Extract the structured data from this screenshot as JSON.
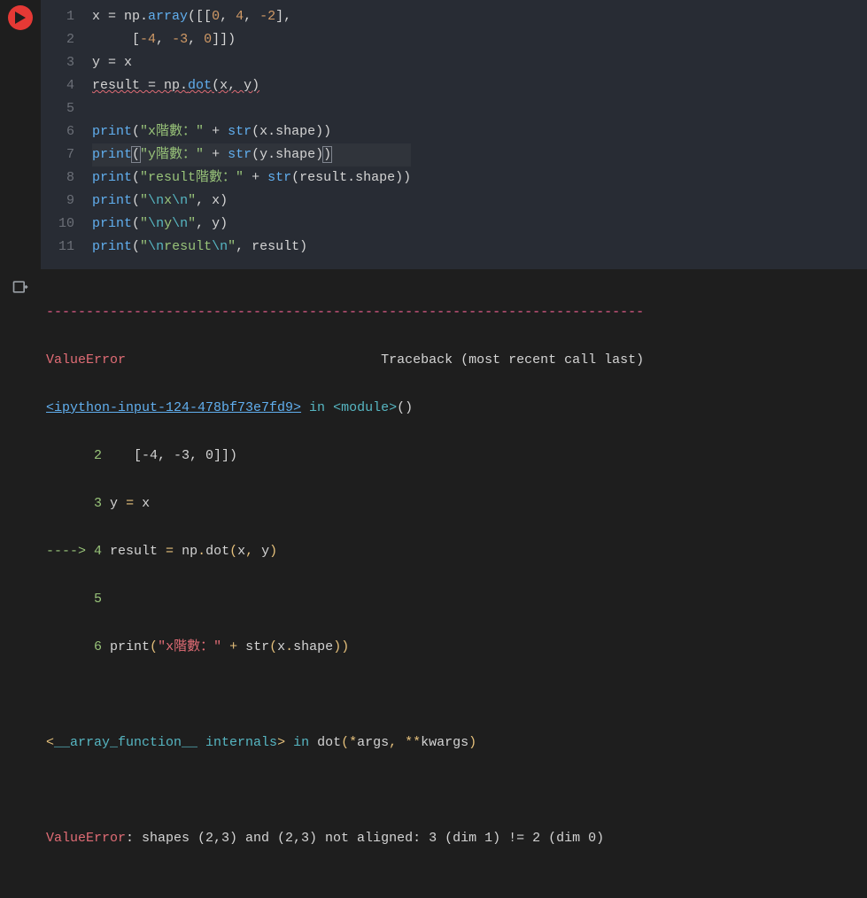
{
  "editor": {
    "line_numbers": [
      "1",
      "2",
      "3",
      "4",
      "5",
      "6",
      "7",
      "8",
      "9",
      "10",
      "11"
    ],
    "active_line": 7,
    "code": {
      "l1": {
        "pre": "x = np.",
        "array": "array",
        "tail": "([[",
        "n0": "0",
        "c1": ", ",
        "n1": "4",
        "c2": ", ",
        "n2": "-2",
        "end": "],"
      },
      "l2": {
        "indent": "     [",
        "n0": "-4",
        "c1": ", ",
        "n1": "-3",
        "c2": ", ",
        "n2": "0",
        "end": "]])"
      },
      "l3": "y = x",
      "l4": {
        "lhs": "result = np.",
        "dot": "dot",
        "args": "(x, y)"
      },
      "l5": "",
      "l6": {
        "p": "print",
        "open": "(",
        "s": "\"x階數：\"",
        "plus": " + ",
        "str": "str",
        "arg": "(x.shape))"
      },
      "l7": {
        "p": "print",
        "open": "(",
        "s": "\"y階數：\"",
        "plus": " + ",
        "str": "str",
        "arg": "(y.shape)",
        "close": ")"
      },
      "l8": {
        "p": "print",
        "open": "(",
        "s": "\"result階數：\"",
        "plus": " + ",
        "str": "str",
        "arg": "(result.shape))"
      },
      "l9": {
        "p": "print",
        "open": "(",
        "s": "\"\\nx\\n\"",
        "rest": ", x)"
      },
      "l10": {
        "p": "print",
        "open": "(",
        "s": "\"\\ny\\n\"",
        "rest": ", y)"
      },
      "l11": {
        "p": "print",
        "open": "(",
        "s": "\"\\nresult\\n\"",
        "rest": ", result)"
      }
    }
  },
  "output": {
    "dashes": "---------------------------------------------------------------------------",
    "error_name": "ValueError",
    "traceback_label": "Traceback (most recent call last)",
    "link": "<ipython-input-124-478bf73e7fd9>",
    "in_label": " in ",
    "module": "<module>",
    "module_tail": "()",
    "tb": [
      {
        "num": "2",
        "code": "    [-4, -3, 0]])",
        "arrow": "      "
      },
      {
        "num": "3",
        "code": " y = x",
        "arrow": "      ",
        "var": "y"
      },
      {
        "num": "4",
        "code": " result = np.dot(x, y)",
        "arrow": "----> "
      },
      {
        "num": "5",
        "code": "",
        "arrow": "      "
      },
      {
        "num": "6",
        "code": " print(\"x階數：\" + str(x.shape))",
        "arrow": "      ",
        "str": "\"x階數：\""
      }
    ],
    "internals_pre": "<",
    "internals_name": "__array_function__ internals",
    "internals_post": ">",
    "internals_in": " in ",
    "internals_func": "dot",
    "internals_args": "(*args, **kwargs)",
    "final_label": "ValueError",
    "final_msg": ": shapes (2,3) and (2,3) not aligned: 3 (dim 1) != 2 (dim 0)"
  }
}
